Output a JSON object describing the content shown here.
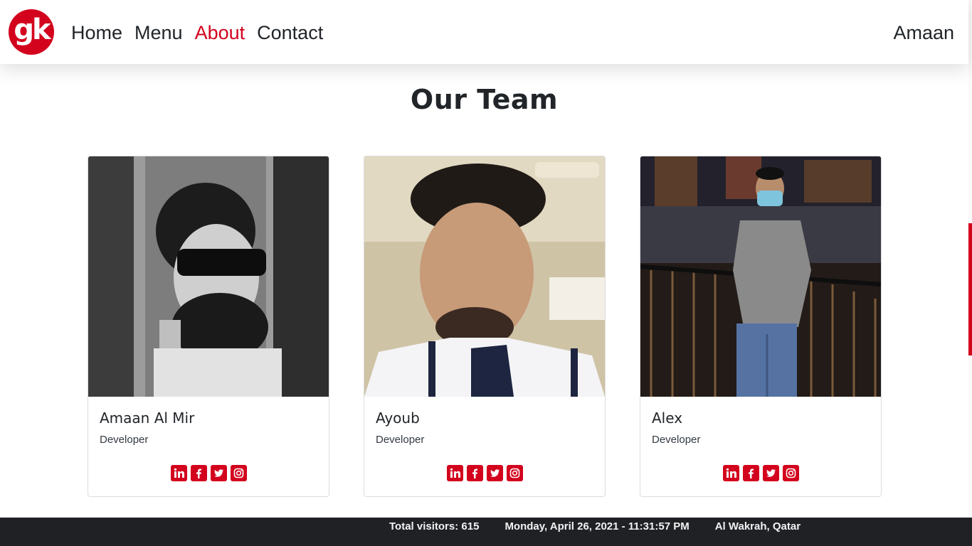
{
  "navbar": {
    "logo_text": "gk",
    "links": [
      {
        "label": "Home",
        "active": false
      },
      {
        "label": "Menu",
        "active": false
      },
      {
        "label": "About",
        "active": true
      },
      {
        "label": "Contact",
        "active": false
      }
    ],
    "user": "Amaan"
  },
  "main": {
    "title": "Our Team",
    "members": [
      {
        "name": "Amaan Al Mir",
        "role": "Developer",
        "socials": [
          "linkedin-icon",
          "facebook-icon",
          "twitter-icon",
          "instagram-icon"
        ]
      },
      {
        "name": "Ayoub",
        "role": "Developer",
        "socials": [
          "linkedin-icon",
          "facebook-icon",
          "twitter-icon",
          "instagram-icon"
        ]
      },
      {
        "name": "Alex",
        "role": "Developer",
        "socials": [
          "linkedin-icon",
          "facebook-icon",
          "twitter-icon",
          "instagram-icon"
        ]
      }
    ]
  },
  "footer": {
    "visitors": "Total visitors: 615",
    "datetime": "Monday, April 26, 2021 - 11:31:57 PM",
    "location": "Al Wakrah, Qatar"
  },
  "colors": {
    "accent": "#d3021d",
    "footer_bg": "#1f2125",
    "text": "#212529"
  }
}
